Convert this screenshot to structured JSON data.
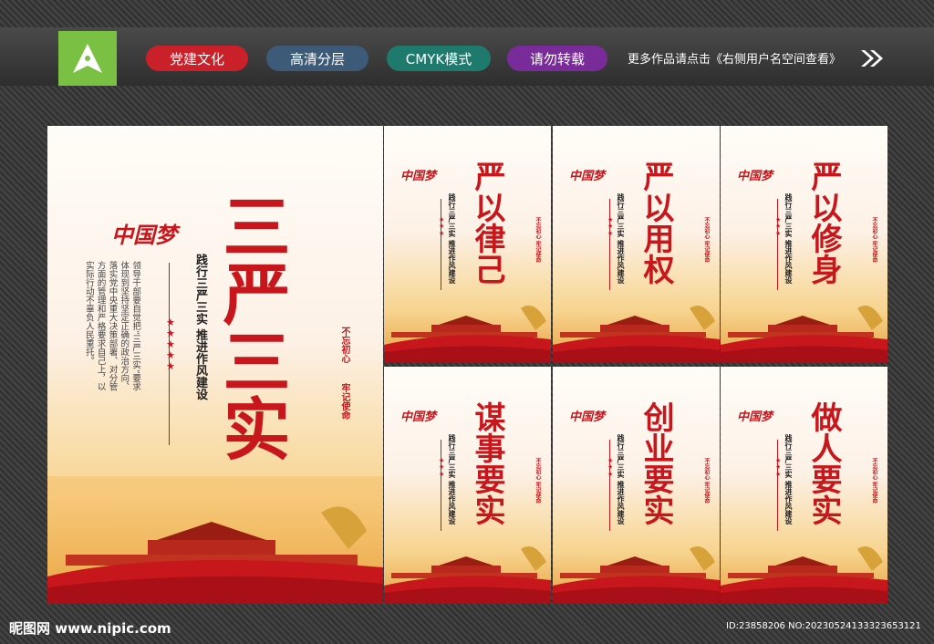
{
  "header": {
    "tags": [
      {
        "label": "党建文化",
        "color": "#c9202a"
      },
      {
        "label": "高清分层",
        "color": "#3d5a78"
      },
      {
        "label": "CMYK模式",
        "color": "#1e7a6c"
      },
      {
        "label": "请勿转载",
        "color": "#7a2b9a"
      }
    ],
    "tagline": "更多作品请点击《右侧用户名空间查看》"
  },
  "main_poster": {
    "title": "三严三实",
    "brand": "中国梦",
    "subtitle": "践行三严三实 推进作风建设",
    "body": "领导干部要自觉把“三严三实”要求体现到坚持坚定正确的政治方向、落实党中央重大决策部署、对分管方面的管理和严格要求自己上，以实际行动不辜负人民重托。",
    "motto_1": "不忘初心",
    "motto_2": "牢记使命"
  },
  "small_posters": [
    {
      "title": "严以律己",
      "subtitle": "践行三严三实 推进作风建设",
      "motto": "不忘初心 牢记使命",
      "brand": "中国梦"
    },
    {
      "title": "严以用权",
      "subtitle": "践行三严三实 推进作风建设",
      "motto": "不忘初心 牢记使命",
      "brand": "中国梦"
    },
    {
      "title": "严以修身",
      "subtitle": "践行三严三实 推进作风建设",
      "motto": "不忘初心 牢记使命",
      "brand": "中国梦"
    },
    {
      "title": "谋事要实",
      "subtitle": "践行三严三实 推进作风建设",
      "motto": "不忘初心 牢记使命",
      "brand": "中国梦"
    },
    {
      "title": "创业要实",
      "subtitle": "践行三严三实 推进作风建设",
      "motto": "不忘初心 牢记使命",
      "brand": "中国梦"
    },
    {
      "title": "做人要实",
      "subtitle": "践行三严三实 推进作风建设",
      "motto": "不忘初心 牢记使命",
      "brand": "中国梦"
    }
  ],
  "footer": {
    "site": "昵图网 www.nipic.com",
    "id_text": "ID:23858206 NO:20230524133323653121"
  },
  "colors": {
    "party_red": "#c8161d",
    "gold": "#e8a040",
    "logo_green": "#7ac143"
  }
}
